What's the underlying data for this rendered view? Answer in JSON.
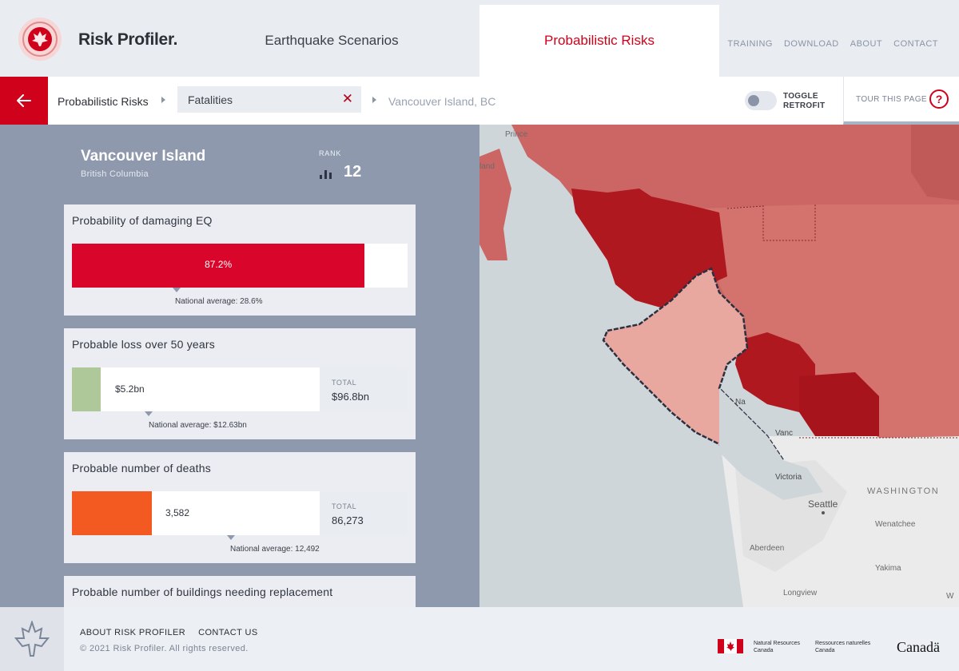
{
  "app": {
    "brand": "Risk Profiler.",
    "tabs": [
      {
        "label": "Earthquake Scenarios",
        "active": false
      },
      {
        "label": "Probabilistic Risks",
        "active": true
      }
    ],
    "top_links": [
      "TRAINING",
      "DOWNLOAD",
      "ABOUT",
      "CONTACT"
    ],
    "accent_color": "#d0021b"
  },
  "breadcrumb": {
    "level1": "Probabilistic Risks",
    "filter": "Fatalities",
    "location": "Vancouver Island, BC"
  },
  "controls": {
    "toggle_label_line1": "TOGGLE",
    "toggle_label_line2": "RETROFIT",
    "toggle_on": false,
    "tour_label": "TOUR THIS PAGE",
    "help_glyph": "?"
  },
  "region": {
    "name": "Vancouver Island",
    "province": "British Columbia",
    "rank_label": "RANK",
    "rank": "12"
  },
  "cards": {
    "probability": {
      "title": "Probability of damaging EQ",
      "value_label": "87.2%",
      "value_fraction": 0.872,
      "average_label": "National average: 28.6%",
      "average_fraction": 0.286,
      "color": "#d9052a"
    },
    "loss": {
      "title": "Probable loss over 50 years",
      "value_label": "$5.2bn",
      "total_label": "TOTAL",
      "total_value": "$96.8bn",
      "average_label": "National average: $12.63bn",
      "color": "#afc89a"
    },
    "deaths": {
      "title": "Probable number of deaths",
      "value_label": "3,582",
      "total_label": "TOTAL",
      "total_value": "86,273",
      "average_label": "National average: 12,492",
      "color": "#f25a22"
    },
    "buildings": {
      "title": "Probable number of buildings needing replacement"
    }
  },
  "map": {
    "labels": [
      "Prince",
      "land",
      "Victoria",
      "Vanc",
      "Na",
      "WASHINGTON",
      "Seattle",
      "Wenatchee",
      "Aberdeen",
      "Yakima",
      "Longview",
      "W"
    ],
    "colors": {
      "dark": "#a8141c",
      "darker": "#b01820",
      "mid": "#cc6664",
      "light": "#d4736d",
      "pale": "#e8a79f",
      "water": "#cfd6d9",
      "land": "#ebebeb"
    }
  },
  "footer": {
    "links": [
      "ABOUT RISK PROFILER",
      "CONTACT US"
    ],
    "copyright": "© 2021 Risk Profiler. All rights reserved.",
    "nrc_en_line1": "Natural Resources",
    "nrc_en_line2": "Canada",
    "nrc_fr_line1": "Ressources naturelles",
    "nrc_fr_line2": "Canada",
    "wordmark": "Canadä"
  }
}
